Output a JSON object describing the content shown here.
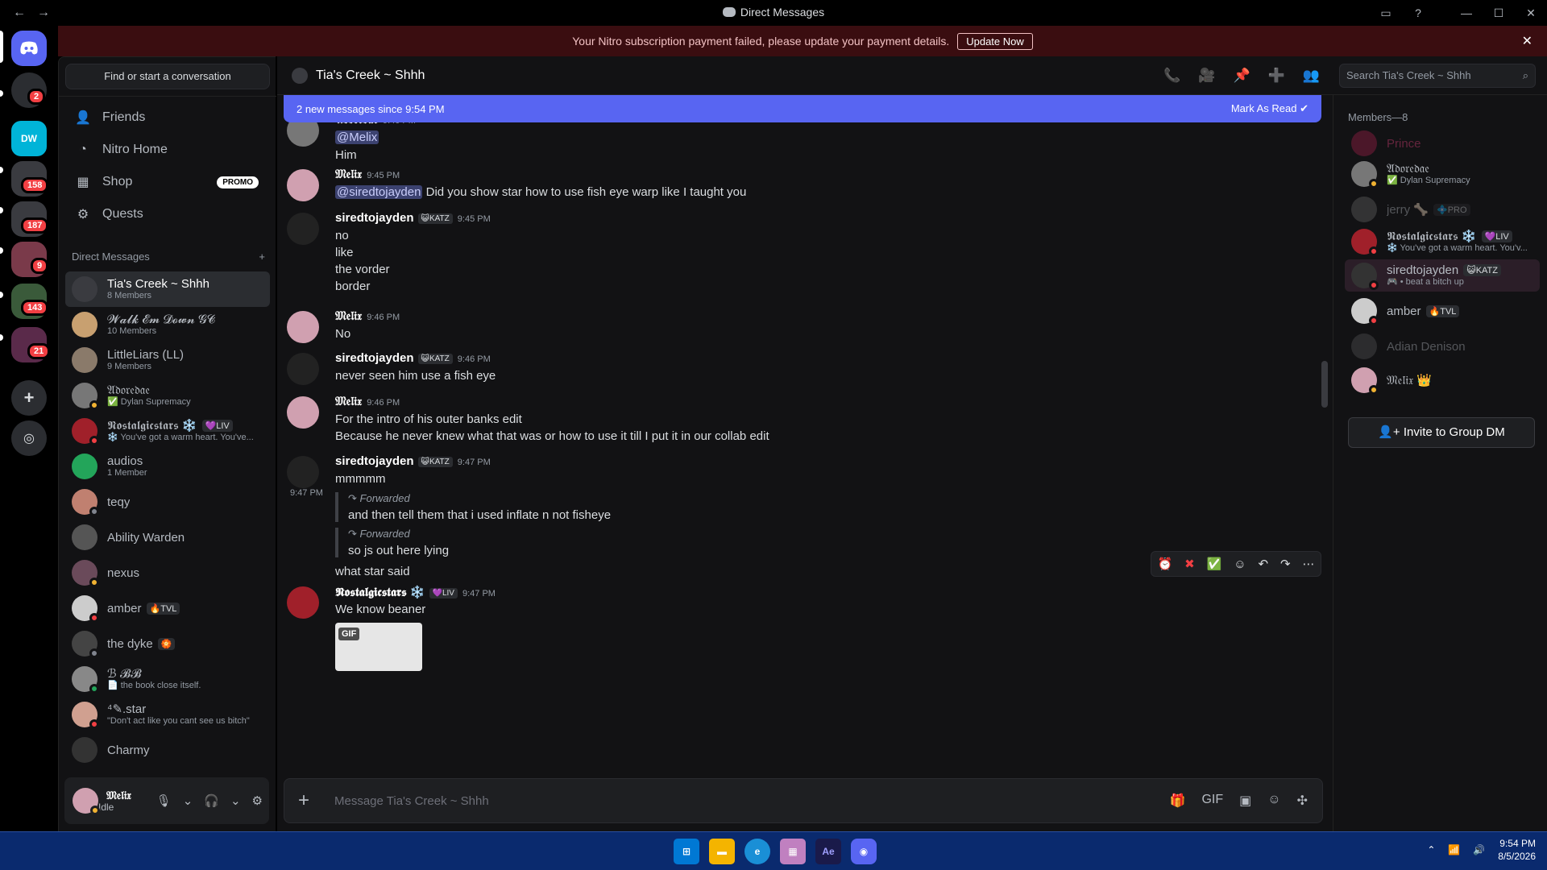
{
  "window": {
    "title": "Direct Messages"
  },
  "rail": {
    "servers": [
      {
        "badge": "2"
      },
      {
        "badge": ""
      },
      {
        "badge": "158"
      },
      {
        "badge": "187"
      },
      {
        "badge": "9"
      },
      {
        "badge": "143"
      },
      {
        "badge": "21"
      }
    ]
  },
  "banner": {
    "text": "Your Nitro subscription payment failed, please update your payment details.",
    "button": "Update Now"
  },
  "sidebar": {
    "find_label": "Find or start a conversation",
    "nav": [
      {
        "label": "Friends"
      },
      {
        "label": "Nitro Home"
      },
      {
        "label": "Shop",
        "badge": "PROMO"
      },
      {
        "label": "Quests"
      }
    ],
    "dm_header": "Direct Messages",
    "dms": [
      {
        "name": "Tia's Creek ~ Shhh",
        "sub": "8 Members",
        "color": "#3a3b40",
        "status": ""
      },
      {
        "name": "𝓦𝓪𝓵𝓴 𝓔𝓶 𝓓𝓸𝔀𝓷 𝓖𝓒",
        "sub": "10 Members",
        "color": "#c8a070",
        "status": ""
      },
      {
        "name": "LittleLiars (LL)",
        "sub": "9 Members",
        "color": "#8a7a6a",
        "status": ""
      },
      {
        "name": "𝔄𝔡𝔬𝔯𝔢𝔡𝔞𝔢",
        "sub": "✅ Dylan Supremacy",
        "color": "#777",
        "status": "#f0b232"
      },
      {
        "name": "𝕹𝖔𝖘𝖙𝖆𝖑𝖌𝖎𝖈𝖘𝖙𝖆𝖗𝖘 ❄️",
        "tag": "💜LIV",
        "sub": "❄️ You've got a warm heart. You've...",
        "color": "#a0202a",
        "status": "#f23f43"
      },
      {
        "name": "audios",
        "sub": "1 Member",
        "color": "#23a55a",
        "status": ""
      },
      {
        "name": "teqy",
        "sub": "",
        "color": "#c08070",
        "status": "#80848e"
      },
      {
        "name": "Ability Warden",
        "sub": "",
        "color": "#555",
        "status": ""
      },
      {
        "name": "nexus",
        "sub": "",
        "color": "#6a4a5a",
        "status": "#f0b232"
      },
      {
        "name": "amber",
        "tag": "🔥TVL",
        "sub": "",
        "color": "#ccc",
        "status": "#f23f43"
      },
      {
        "name": "the dyke",
        "tag": "🏵️",
        "sub": "",
        "color": "#444",
        "status": "#80848e"
      },
      {
        "name": "ℬ 𝓑𝓑",
        "sub": "📄 the book close itself.",
        "color": "#888",
        "status": "#23a55a"
      },
      {
        "name": "⁴✎.star",
        "sub": "\"Don't act like you cant see us bitch\"",
        "color": "#d0a090",
        "status": "#f23f43"
      },
      {
        "name": "Charmy",
        "sub": "",
        "color": "#333",
        "status": ""
      }
    ]
  },
  "user": {
    "name": "𝔐𝔢𝔩𝔦𝔵",
    "status": "Idle"
  },
  "chat": {
    "title": "Tia's Creek ~ Shhh",
    "search_placeholder": "Search Tia's Creek ~ Shhh",
    "new_messages": "2 new messages since 9:54 PM",
    "mark_read": "Mark As Read",
    "composer_placeholder": "Message Tia's Creek ~ Shhh",
    "messages": [
      {
        "author": "𝔄𝔡𝔬𝔯𝔢𝔡𝔞𝔢",
        "time": "9:40 PM",
        "mention": "@Melix",
        "lines": [
          "Him"
        ]
      },
      {
        "author": "𝔐𝔢𝔩𝔦𝔵",
        "time": "9:45 PM",
        "mention": "@siredtojayden",
        "text": "Did you show star how to use fish eye warp like I taught you"
      },
      {
        "author": "siredtojayden",
        "tag": "😺KATZ",
        "time": "9:45 PM",
        "lines": [
          "no",
          "like",
          "the vorder",
          "border"
        ]
      },
      {
        "author": "𝔐𝔢𝔩𝔦𝔵",
        "time": "9:46 PM",
        "lines": [
          "No"
        ]
      },
      {
        "author": "siredtojayden",
        "tag": "😺KATZ",
        "time": "9:46 PM",
        "lines": [
          "never seen him use a fish eye"
        ]
      },
      {
        "author": "𝔐𝔢𝔩𝔦𝔵",
        "time": "9:46 PM",
        "lines": [
          "For the intro of his outer banks edit",
          "Because he never knew what that was or how to use it till I put it in our collab edit"
        ]
      },
      {
        "author": "siredtojayden",
        "tag": "😺KATZ",
        "time": "9:47 PM",
        "lines": [
          "mmmmm"
        ],
        "side_time": "9:47 PM",
        "forwards": [
          {
            "label": "Forwarded",
            "text": "and then tell them that i used inflate n not fisheye"
          },
          {
            "label": "Forwarded",
            "text": "so js out here lying"
          }
        ],
        "after": "what star said"
      },
      {
        "author": "𝕹𝖔𝖘𝖙𝖆𝖑𝖌𝖎𝖈𝖘𝖙𝖆𝖗𝖘 ❄️",
        "tag": "💜LIV",
        "time": "9:47 PM",
        "lines": [
          "We know beaner"
        ],
        "gif": "GIF"
      }
    ]
  },
  "members": {
    "header": "Members—8",
    "list": [
      {
        "name": "Prince",
        "color": "#a0204a",
        "dim": true
      },
      {
        "name": "𝔄𝔡𝔬𝔯𝔢𝔡𝔞𝔢",
        "sub": "✅ Dylan Supremacy",
        "color": "#777"
      },
      {
        "name": "jerry 🦴",
        "tag": "💠PRO",
        "color": "#666",
        "dim": true
      },
      {
        "name": "𝕹𝖔𝖘𝖙𝖆𝖑𝖌𝖎𝖈𝖘𝖙𝖆𝖗𝖘 ❄️",
        "tag": "💜LIV",
        "sub": "❄️ You've got a warm heart. You'v...",
        "color": "#a0202a"
      },
      {
        "name": "siredtojayden",
        "tag": "😺KATZ",
        "sub": "🎮 • beat a bitch up",
        "color": "#333"
      },
      {
        "name": "amber",
        "tag": "🔥TVL",
        "color": "#ccc"
      },
      {
        "name": "Adian Denison",
        "color": "#555",
        "dim": true
      },
      {
        "name": "𝔐𝔢𝔩𝔦𝔵 👑",
        "color": "#d0a0b0"
      }
    ],
    "invite": "Invite to Group DM"
  },
  "taskbar": {
    "time": "9:54 PM",
    "date": "8/5/2026"
  }
}
